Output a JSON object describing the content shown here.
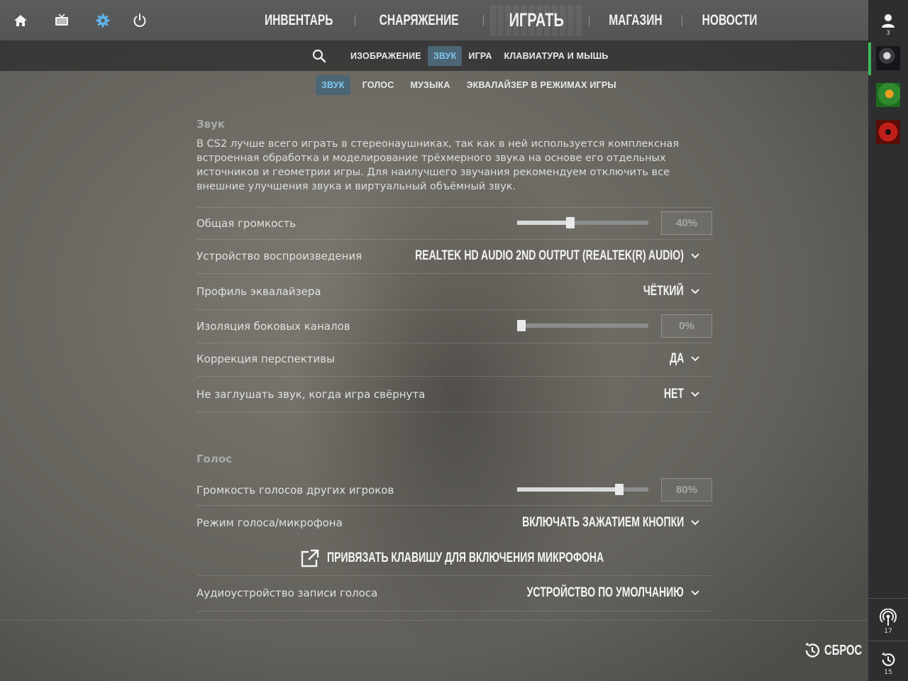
{
  "topnav": {
    "items": [
      "ИНВЕНТАРЬ",
      "СНАРЯЖЕНИЕ",
      "ИГРАТЬ",
      "МАГАЗИН",
      "НОВОСТИ"
    ],
    "active": "ИГРАТЬ"
  },
  "settings_tabs": [
    "ИЗОБРАЖЕНИЕ",
    "ЗВУК",
    "ИГРА",
    "КЛАВИАТУРА И МЫШЬ"
  ],
  "settings_tab_active": "ЗВУК",
  "sub_tabs": [
    "ЗВУК",
    "ГОЛОС",
    "МУЗЫКА",
    "ЭКВАЛАЙЗЕР В РЕЖИМАХ ИГРЫ"
  ],
  "sub_tab_active": "ЗВУК",
  "sound": {
    "title": "Звук",
    "description": "В CS2 лучше всего играть в стереонаушниках, так как в ней используется комплексная встроенная обработка и моделирование трёхмерного звука на основе его отдельных источников и геометрии игры. Для наилучшего звучания рекомендуем отключить все внешние улучшения звука и виртуальный объёмный звук.",
    "master_volume": {
      "label": "Общая громкость",
      "value": "40%",
      "level": 0.4
    },
    "playback_device": {
      "label": "Устройство воспроизведения",
      "value": "REALTEK HD AUDIO 2ND OUTPUT (REALTEK(R) AUDIO)"
    },
    "eq_profile": {
      "label": "Профиль эквалайзера",
      "value": "ЧЁТКИЙ"
    },
    "l_r_isolation": {
      "label": "Изоляция боковых каналов",
      "value": "0%",
      "level": 0.0
    },
    "perspective_correction": {
      "label": "Коррекция перспективы",
      "value": "ДА"
    },
    "mute_when_minimized": {
      "label": "Не заглушать звук, когда игра свёрнута",
      "value": "НЕТ"
    }
  },
  "voice": {
    "title": "Голос",
    "player_voice_volume": {
      "label": "Громкость голосов других игроков",
      "value": "80%",
      "level": 0.8
    },
    "voice_mode": {
      "label": "Режим голоса/микрофона",
      "value": "ВКЛЮЧАТЬ ЗАЖАТИЕМ КНОПКИ"
    },
    "bind_key_label": "ПРИВЯЗАТЬ КЛАВИШУ ДЛЯ ВКЛЮЧЕНИЯ МИКРОФОНА",
    "recording_device": {
      "label": "Аудиоустройство записи голоса",
      "value": "УСТРОЙСТВО ПО УМОЛЧАНИЮ"
    }
  },
  "reset_label": "СБРОС",
  "sidebar": {
    "friends_count": "3",
    "broadcast_count": "17",
    "history_count": "15"
  },
  "colors": {
    "accent": "#7fc8f0",
    "active_tab_bg": "#4d6675",
    "online_green": "#3cb85a"
  }
}
